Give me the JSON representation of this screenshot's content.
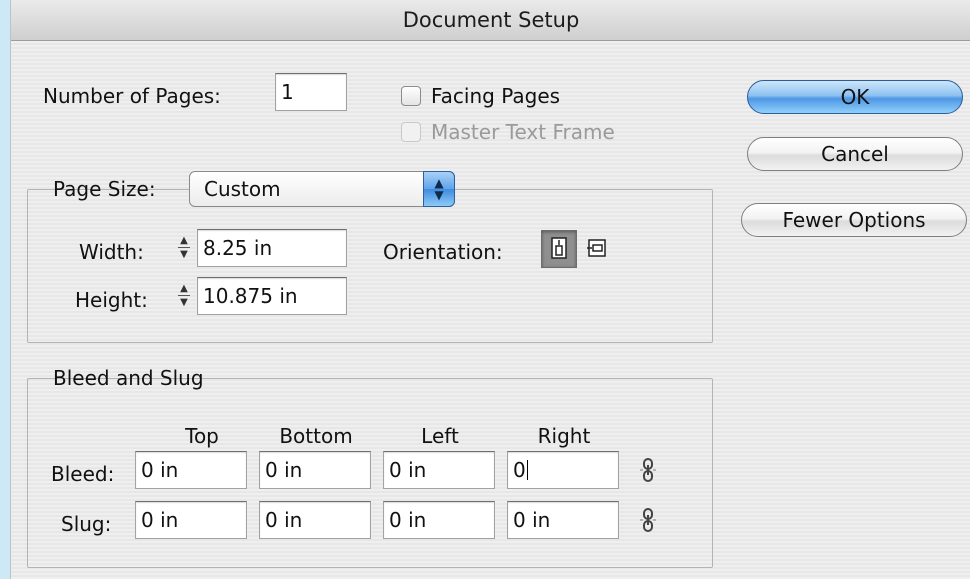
{
  "window": {
    "title": "Document Setup"
  },
  "top": {
    "pages_label": "Number of Pages:",
    "pages_value": "1",
    "facing_pages_label": "Facing Pages",
    "facing_pages_checked": false,
    "master_text_frame_label": "Master Text Frame",
    "master_text_frame_checked": false
  },
  "buttons": {
    "ok": "OK",
    "cancel": "Cancel",
    "fewer_options": "Fewer Options"
  },
  "page_size": {
    "label": "Page Size:",
    "selected": "Custom",
    "width_label": "Width:",
    "width_value": "8.25 in",
    "height_label": "Height:",
    "height_value": "10.875 in",
    "orientation_label": "Orientation:",
    "orientation_selected": "portrait",
    "portrait_icon": "portrait-orientation-icon",
    "landscape_icon": "landscape-orientation-icon"
  },
  "bleed_slug": {
    "legend": "Bleed and Slug",
    "columns": [
      "Top",
      "Bottom",
      "Left",
      "Right"
    ],
    "rows": [
      {
        "label": "Bleed:",
        "values": [
          "0 in",
          "0 in",
          "0 in",
          "0"
        ],
        "link_icon": "chain-link-icon"
      },
      {
        "label": "Slug:",
        "values": [
          "0 in",
          "0 in",
          "0 in",
          "0 in"
        ],
        "link_icon": "chain-link-icon"
      }
    ]
  },
  "colors": {
    "default_button": "#5ea3ea",
    "background": "#cde9f6"
  }
}
